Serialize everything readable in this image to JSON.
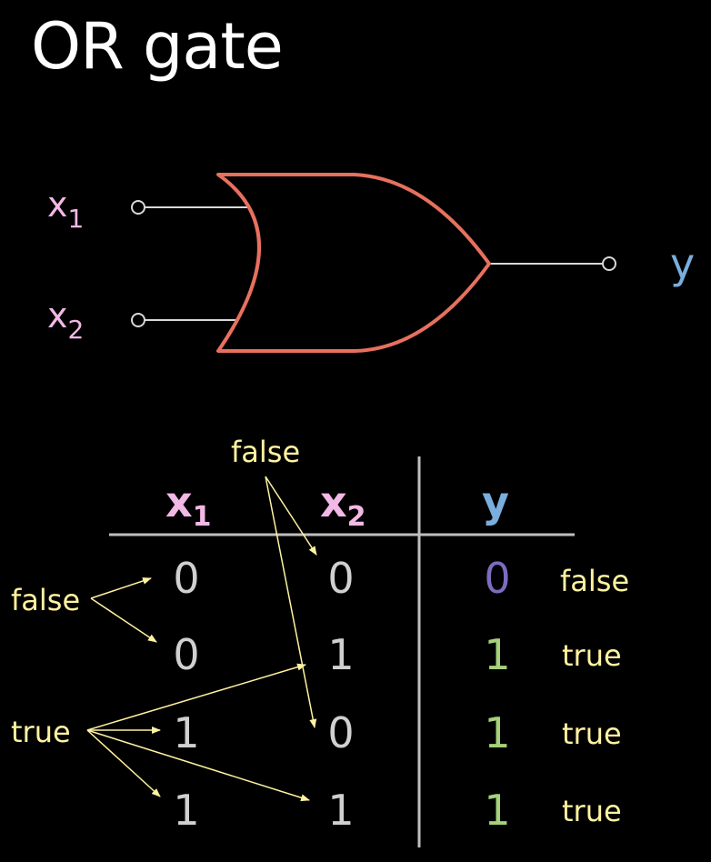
{
  "title": "OR gate",
  "gate": {
    "input_1": {
      "var": "x",
      "sub": "1"
    },
    "input_2": {
      "var": "x",
      "sub": "2"
    },
    "output": "y"
  },
  "truth_table": {
    "headers": [
      {
        "var": "x",
        "sub": "1"
      },
      {
        "var": "x",
        "sub": "2"
      },
      {
        "var": "y",
        "sub": ""
      }
    ],
    "rows": [
      {
        "x1": "0",
        "x2": "0",
        "y": "0",
        "y_word": "false"
      },
      {
        "x1": "0",
        "x2": "1",
        "y": "1",
        "y_word": "true"
      },
      {
        "x1": "1",
        "x2": "0",
        "y": "1",
        "y_word": "true"
      },
      {
        "x1": "1",
        "x2": "1",
        "y": "1",
        "y_word": "true"
      }
    ]
  },
  "annotations": {
    "top_false": "false",
    "left_false": "false",
    "left_true": "true"
  },
  "colors": {
    "background": "#000000",
    "title": "#ffffff",
    "gate_outline": "#e8705e",
    "wire": "#d8d8d8",
    "input_label": "#f2b8e6",
    "output_label": "#7aaede",
    "table_line": "#bfbfbf",
    "table_digit": "#d0d0d0",
    "output_zero": "#7d6cbf",
    "output_one": "#a6d07a",
    "annotation": "#fff3a0"
  }
}
